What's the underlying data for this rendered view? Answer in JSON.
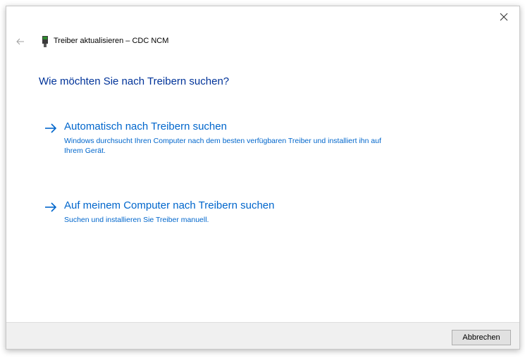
{
  "window": {
    "title": "Treiber aktualisieren – CDC NCM",
    "close_icon": "close-icon",
    "back_icon": "back-arrow-icon",
    "device_icon": "usb-device-icon"
  },
  "main": {
    "question": "Wie möchten Sie nach Treibern suchen?",
    "options": [
      {
        "title": "Automatisch nach Treibern suchen",
        "description": "Windows durchsucht Ihren Computer nach dem besten verfügbaren Treiber und installiert ihn auf Ihrem Gerät."
      },
      {
        "title": "Auf meinem Computer nach Treibern suchen",
        "description": "Suchen und installieren Sie Treiber manuell."
      }
    ]
  },
  "footer": {
    "cancel_label": "Abbrechen"
  },
  "colors": {
    "accent": "#0066cc",
    "heading": "#003399",
    "footer_bg": "#f0f0f0"
  }
}
